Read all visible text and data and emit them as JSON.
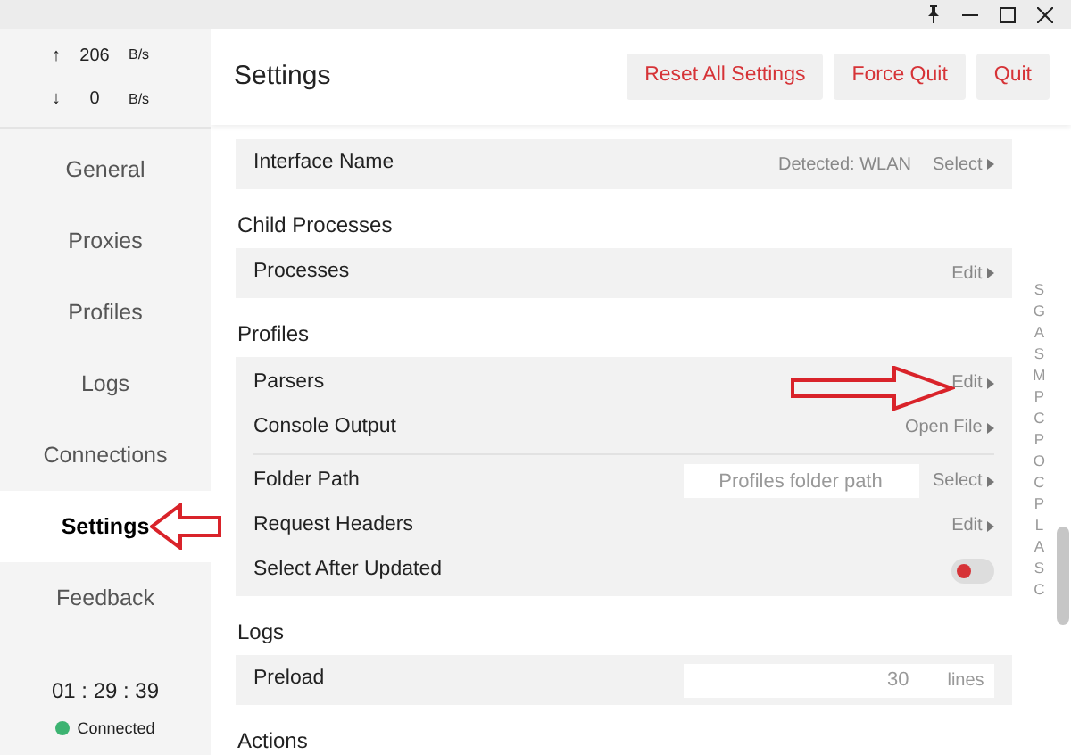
{
  "traffic": [
    {
      "arrow": "↑",
      "value": "206",
      "unit": "B/s"
    },
    {
      "arrow": "↓",
      "value": "0",
      "unit": "B/s"
    }
  ],
  "nav": [
    {
      "label": "General",
      "selected": false
    },
    {
      "label": "Proxies",
      "selected": false
    },
    {
      "label": "Profiles",
      "selected": false
    },
    {
      "label": "Logs",
      "selected": false
    },
    {
      "label": "Connections",
      "selected": false
    },
    {
      "label": "Settings",
      "selected": true
    },
    {
      "label": "Feedback",
      "selected": false
    }
  ],
  "timer": "01 : 29 : 39",
  "status": "Connected",
  "page": {
    "title": "Settings",
    "buttons": [
      "Reset All Settings",
      "Force Quit",
      "Quit"
    ]
  },
  "sections": [
    {
      "groups": [
        [
          {
            "kind": "action",
            "label": "Interface Name",
            "detail": "Detected: WLAN",
            "action": "Select"
          }
        ]
      ]
    },
    {
      "title": "Child Processes",
      "groups": [
        [
          {
            "kind": "action",
            "label": "Processes",
            "action": "Edit"
          }
        ]
      ]
    },
    {
      "title": "Profiles",
      "groups": [
        [
          {
            "kind": "action",
            "label": "Parsers",
            "action": "Edit"
          },
          {
            "kind": "action",
            "label": "Console Output",
            "action": "Open File"
          }
        ],
        [
          {
            "kind": "path",
            "label": "Folder Path",
            "placeholder": "Profiles folder path",
            "action": "Select"
          },
          {
            "kind": "action",
            "label": "Request Headers",
            "action": "Edit"
          },
          {
            "kind": "switch",
            "label": "Select After Updated",
            "on": false
          }
        ]
      ]
    },
    {
      "title": "Logs",
      "groups": [
        [
          {
            "kind": "number",
            "label": "Preload",
            "value": "30",
            "unit": "lines"
          }
        ]
      ]
    },
    {
      "title": "Actions"
    }
  ],
  "index_letters": [
    "S",
    "G",
    "A",
    "S",
    "M",
    "P",
    "C",
    "P",
    "O",
    "C",
    "P",
    "L",
    "A",
    "S",
    "C"
  ]
}
